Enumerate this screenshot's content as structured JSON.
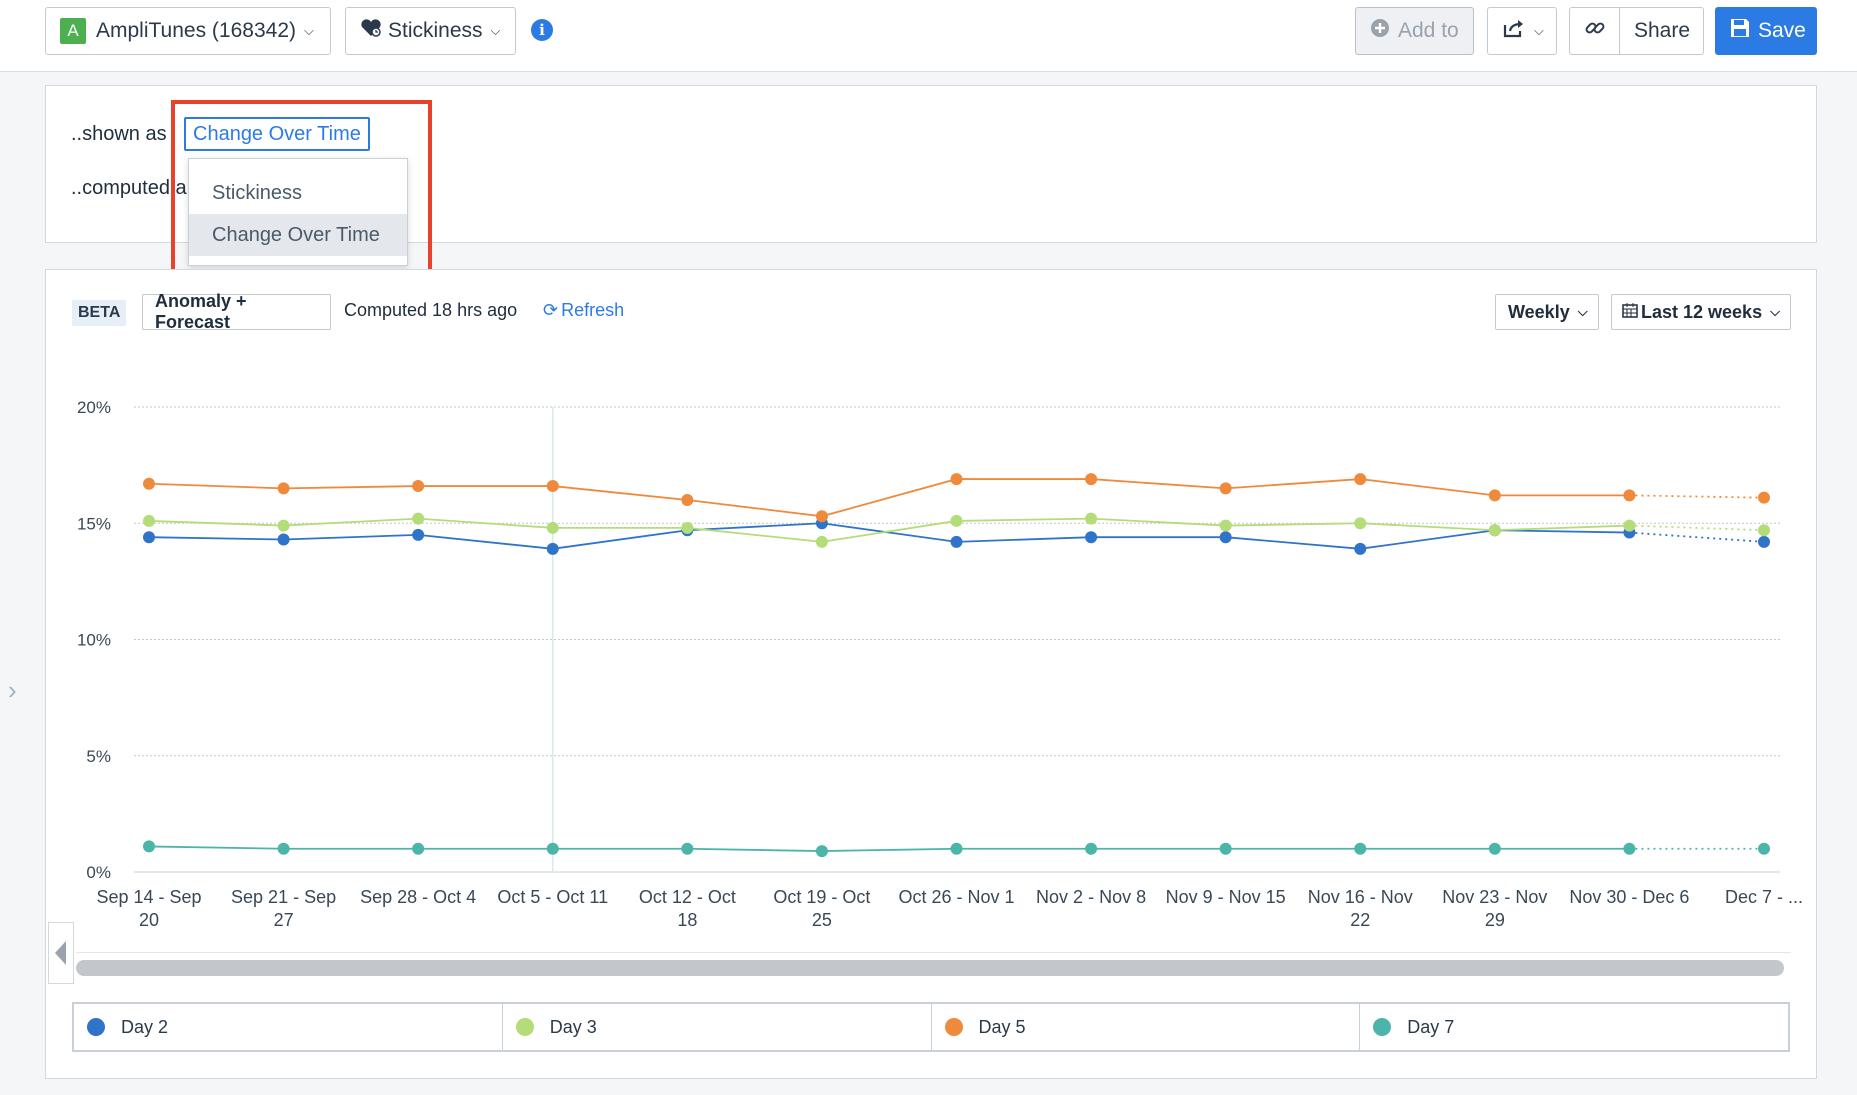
{
  "topbar": {
    "app_badge": "A",
    "app_label": "AmpliTunes (168342)",
    "chart_type_label": "Stickiness",
    "info_glyph": "i",
    "add_to_label": "Add to",
    "share_label": "Share",
    "save_label": "Save"
  },
  "settings": {
    "shown_as_label": "..shown as",
    "computed_label": "..computed a",
    "selected_option": "Change Over Time",
    "options": [
      "Stickiness",
      "Change Over Time"
    ]
  },
  "toolbar": {
    "beta": "BETA",
    "anomaly_label": "Anomaly + Forecast",
    "computed_text": "Computed 18 hrs ago",
    "refresh_label": "Refresh",
    "interval_label": "Weekly",
    "range_label": "Last 12 weeks"
  },
  "colors": {
    "day2": "#2f74c8",
    "day3": "#b4dc78",
    "day5": "#ef8a3c",
    "day7": "#4cb5aa",
    "accent": "#2c7be5",
    "highlight": "#e8412c"
  },
  "chart_data": {
    "type": "line",
    "y_tick_labels": [
      "0%",
      "5%",
      "10%",
      "15%",
      "20%"
    ],
    "ylim": [
      0,
      20
    ],
    "grid": true,
    "categories": [
      [
        "Sep 14 - Sep",
        "20"
      ],
      [
        "Sep 21 - Sep",
        "27"
      ],
      [
        "Sep 28 - Oct 4"
      ],
      [
        "Oct 5 - Oct 11"
      ],
      [
        "Oct 12 - Oct",
        "18"
      ],
      [
        "Oct 19 - Oct",
        "25"
      ],
      [
        "Oct 26 - Nov 1"
      ],
      [
        "Nov 2 - Nov 8"
      ],
      [
        "Nov 9 - Nov 15"
      ],
      [
        "Nov 16 - Nov",
        "22"
      ],
      [
        "Nov 23 - Nov",
        "29"
      ],
      [
        "Nov 30 - Dec 6"
      ],
      [
        "Dec 7 - ..."
      ]
    ],
    "forecast_from_index": 11,
    "series": [
      {
        "name": "Day 2",
        "color": "#2f74c8",
        "values": [
          14.4,
          14.3,
          14.5,
          13.9,
          14.7,
          15.0,
          14.2,
          14.4,
          14.4,
          13.9,
          14.7,
          14.6,
          14.2
        ]
      },
      {
        "name": "Day 3",
        "color": "#b4dc78",
        "values": [
          15.1,
          14.9,
          15.2,
          14.8,
          14.8,
          14.2,
          15.1,
          15.2,
          14.9,
          15.0,
          14.7,
          14.9,
          14.7
        ]
      },
      {
        "name": "Day 5",
        "color": "#ef8a3c",
        "values": [
          16.7,
          16.5,
          16.6,
          16.6,
          16.0,
          15.3,
          16.9,
          16.9,
          16.5,
          16.9,
          16.2,
          16.2,
          16.1
        ]
      },
      {
        "name": "Day 7",
        "color": "#4cb5aa",
        "values": [
          1.1,
          1.0,
          1.0,
          1.0,
          1.0,
          0.9,
          1.0,
          1.0,
          1.0,
          1.0,
          1.0,
          1.0,
          1.0
        ]
      }
    ]
  },
  "legend": [
    {
      "name": "Day 2",
      "color": "#2f74c8"
    },
    {
      "name": "Day 3",
      "color": "#b4dc78"
    },
    {
      "name": "Day 5",
      "color": "#ef8a3c"
    },
    {
      "name": "Day 7",
      "color": "#4cb5aa"
    }
  ]
}
